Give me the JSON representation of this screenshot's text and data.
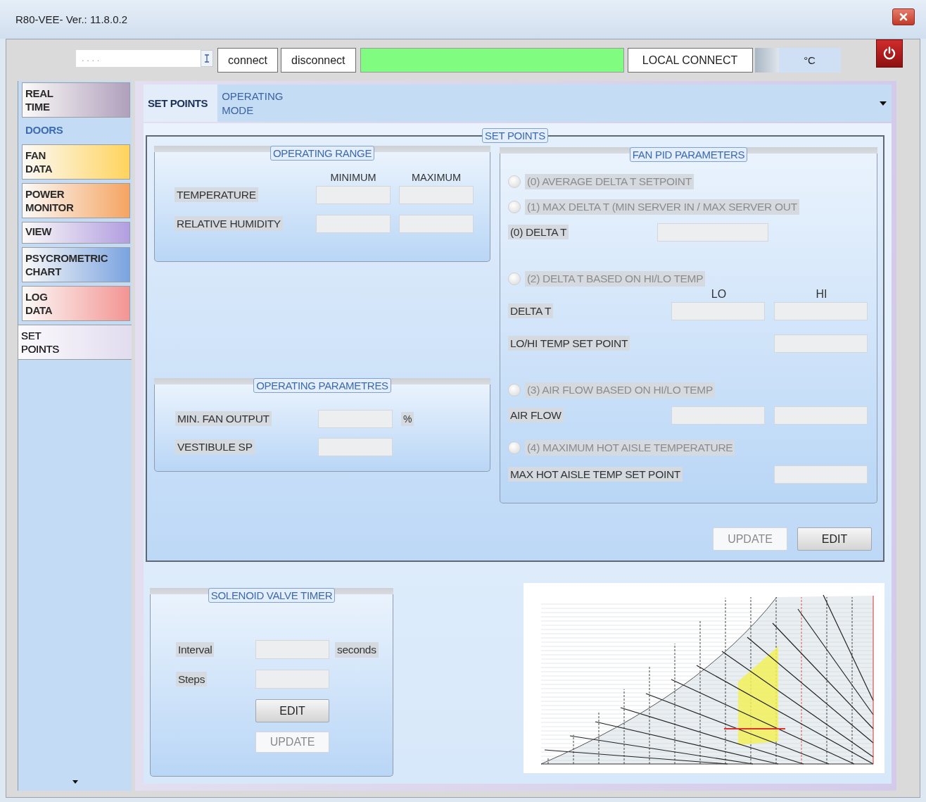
{
  "window": {
    "title": "R80-VEE- Ver.: 11.8.0.2"
  },
  "toolbar": {
    "address": {
      "value": ". . . ."
    },
    "buttons": [
      {
        "label": "connect"
      },
      {
        "label": "disconnect"
      }
    ],
    "connected": true,
    "local_connect": "LOCAL CONNECT",
    "unit": "°C"
  },
  "sidebar": {
    "items": [
      {
        "label": "REAL TIME",
        "kind": "tab",
        "color": "#b0a0bc",
        "selected": false
      },
      {
        "label": "DOORS",
        "kind": "plain",
        "selected": false
      },
      {
        "label": "FAN DATA",
        "kind": "tab",
        "color": "#ffd35c",
        "selected": false
      },
      {
        "label": "POWER MONITOR",
        "kind": "tab",
        "color": "#f5a462",
        "selected": false
      },
      {
        "label": "VIEW",
        "kind": "tab",
        "color": "#b29ee0",
        "selected": false
      },
      {
        "label": "PSYCROMETRIC CHART",
        "kind": "tab",
        "color": "#7aa3e0",
        "selected": false
      },
      {
        "label": "LOG DATA",
        "kind": "tab",
        "color": "#f39593",
        "selected": false
      },
      {
        "label": "SET POINTS",
        "kind": "tab",
        "color": "#e2dcef",
        "selected": true
      }
    ]
  },
  "tabs": [
    {
      "label": "SET POINTS",
      "selected": true
    },
    {
      "label": "OPERATING MODE",
      "selected": false
    }
  ],
  "set_points": {
    "title": "SET POINTS",
    "operating_range": {
      "title": "OPERATING RANGE",
      "columns": [
        "MINIMUM",
        "MAXIMUM"
      ],
      "rows": [
        {
          "label": "TEMPERATURE"
        },
        {
          "label": "RELATIVE HUMIDITY"
        }
      ]
    },
    "operating_parametres": {
      "title": "OPERATING PARAMETRES",
      "rows": [
        {
          "label": "MIN. FAN OUTPUT",
          "unit": "%"
        },
        {
          "label": "VESTIBULE SP"
        }
      ]
    },
    "fan_pid": {
      "title": "FAN PID PARAMETERS",
      "rows": [
        {
          "kind": "option",
          "label": "(0) AVERAGE DELTA T SETPOINT",
          "checked": false,
          "disabled": true
        },
        {
          "kind": "option",
          "label": "(1) MAX DELTA T (MIN SERVER IN / MAX SERVER OUT",
          "checked": false,
          "disabled": true
        },
        {
          "kind": "field",
          "label": "(0) DELTA T"
        },
        {
          "kind": "option",
          "label": "(2) DELTA T BASED ON HI/LO TEMP",
          "checked": false,
          "disabled": true
        },
        {
          "kind": "columns",
          "labels": [
            "LO",
            "HI"
          ]
        },
        {
          "kind": "pair",
          "label": "DELTA T"
        },
        {
          "kind": "right",
          "label": "LO/HI TEMP SET POINT"
        },
        {
          "kind": "option",
          "label": "(3) AIR FLOW BASED ON HI/LO TEMP",
          "checked": false,
          "disabled": true
        },
        {
          "kind": "pair",
          "label": "AIR FLOW"
        },
        {
          "kind": "option",
          "label": "(4) MAXIMUM HOT AISLE TEMPERATURE",
          "checked": false,
          "disabled": true
        },
        {
          "kind": "right",
          "label": "MAX HOT AISLE TEMP SET POINT"
        }
      ]
    },
    "buttons": [
      {
        "label": "UPDATE",
        "disabled": true
      },
      {
        "label": "EDIT",
        "disabled": false
      }
    ]
  },
  "solenoid_valve_timer": {
    "title": "SOLENOID VALVE TIMER",
    "rows": [
      {
        "label": "Interval",
        "unit": "seconds"
      },
      {
        "label": "Steps"
      }
    ],
    "buttons": [
      {
        "label": "EDIT",
        "disabled": false
      },
      {
        "label": "UPDATE",
        "disabled": true
      }
    ]
  }
}
